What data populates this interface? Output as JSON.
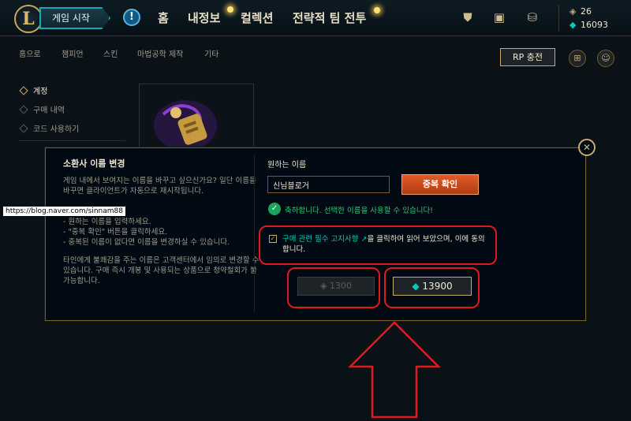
{
  "topbar": {
    "logo": "L",
    "play_button": "게임 시작",
    "alert_icon": "!",
    "nav": [
      "홈",
      "내정보",
      "컬렉션",
      "전략적 팀 전투"
    ],
    "icons": [
      "shield-icon",
      "chest-icon",
      "store-coins-icon"
    ],
    "currency": {
      "rp": "26",
      "be": "16093"
    }
  },
  "subnav": {
    "items": [
      "홈으로",
      "챔피언",
      "스킨",
      "마법공학 제작",
      "기타"
    ],
    "rp_button": "RP 충전"
  },
  "sidebar": {
    "items": [
      {
        "label": "계정",
        "active": true
      },
      {
        "label": "구매 내역",
        "active": false
      },
      {
        "label": "코드 사용하기",
        "active": false
      }
    ]
  },
  "modal": {
    "title": "소환사 이름 변경",
    "description": "게임 내에서 보여지는 이름을 바꾸고 싶으신가요? 일단 이름을 바꾸면 클라이언트가 자동으로 재시작됩니다.",
    "steps": [
      "- 원하는 이름을 입력하세요.",
      "- \"중복 확인\" 버튼을 클릭하세요.",
      "- 중복된 이름이 없다면 이름을 변경하실 수 있습니다."
    ],
    "warning": "타인에게 불쾌감을 주는 이름은 고객센터에서 임의로 변경할 수 있습니다. 구매 즉시 개봉 및 사용되는 상품으로 청약철회가 불가능합니다.",
    "name_label": "원하는 이름",
    "name_value": "신님블로거",
    "check_button": "중복 확인",
    "success_text": "축하합니다. 선택한 이름을 사용할 수 있습니다!",
    "agree_prefix": "",
    "agree_link": "구매 관련 필수 고지사항",
    "agree_suffix": "을 클릭하여 읽어 보았으며, 이에 동의합니다.",
    "price_rp": "1300",
    "price_be": "13900",
    "close": "✕"
  },
  "watermark": "https://blog.naver.com/sinnam88",
  "colors": {
    "accent_gold": "#c8aa6e",
    "teal": "#0ac8b9",
    "annotation_red": "#e0191e",
    "button_orange": "#d9501f"
  }
}
